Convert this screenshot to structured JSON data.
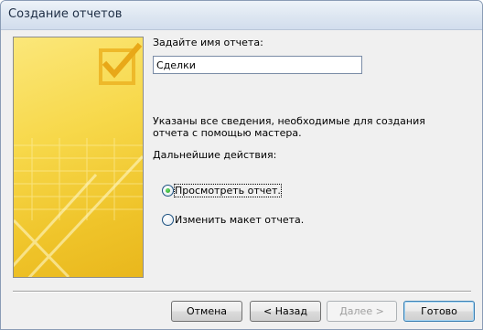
{
  "window": {
    "title": "Создание отчетов"
  },
  "form": {
    "name_label": "Задайте имя отчета:",
    "name_value": "Сделки",
    "info_text": "Указаны все сведения, необходимые для создания отчета с помощью мастера.",
    "next_actions_label": "Дальнейшие действия:",
    "options": [
      {
        "label": "Просмотреть отчет.",
        "checked": true
      },
      {
        "label": "Изменить макет отчета.",
        "checked": false
      }
    ]
  },
  "buttons": {
    "cancel": "Отмена",
    "back": "< Назад",
    "next": "Далее >",
    "finish": "Готово"
  },
  "colors": {
    "banner": "#f7d84a",
    "accent": "#3c7fb1"
  }
}
